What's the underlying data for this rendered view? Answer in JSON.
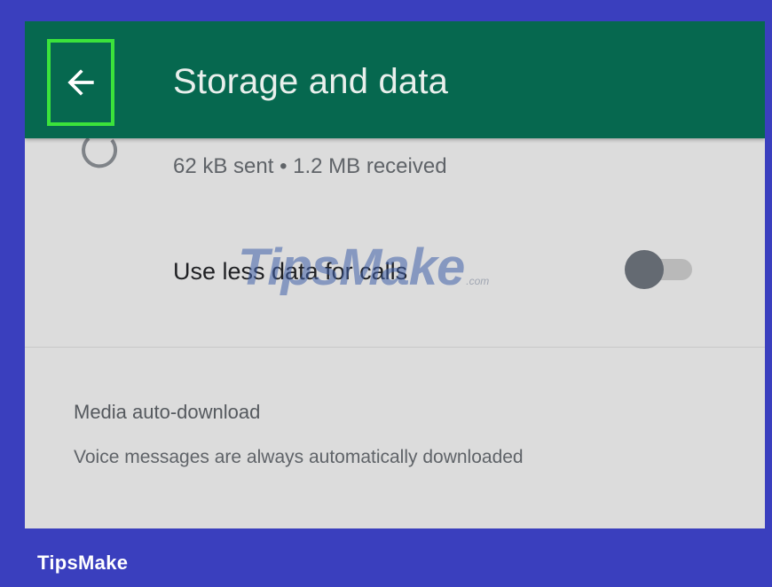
{
  "header": {
    "title": "Storage and data",
    "back_icon": "arrow-left-icon",
    "background_color": "#06684f",
    "highlight_color": "#3be33b"
  },
  "network_usage": {
    "icon": "data-usage-icon",
    "value": "62 kB sent • 1.2 MB received"
  },
  "calls_setting": {
    "label": "Use less data for calls",
    "enabled": false
  },
  "media_auto_download": {
    "title": "Media auto-download",
    "subtitle": "Voice messages are always automatically downloaded"
  },
  "watermark": {
    "text": "TipsMake",
    "suffix": ".com"
  },
  "footer": {
    "brand": "TipsMake",
    "background_color": "#3a3fbe"
  }
}
